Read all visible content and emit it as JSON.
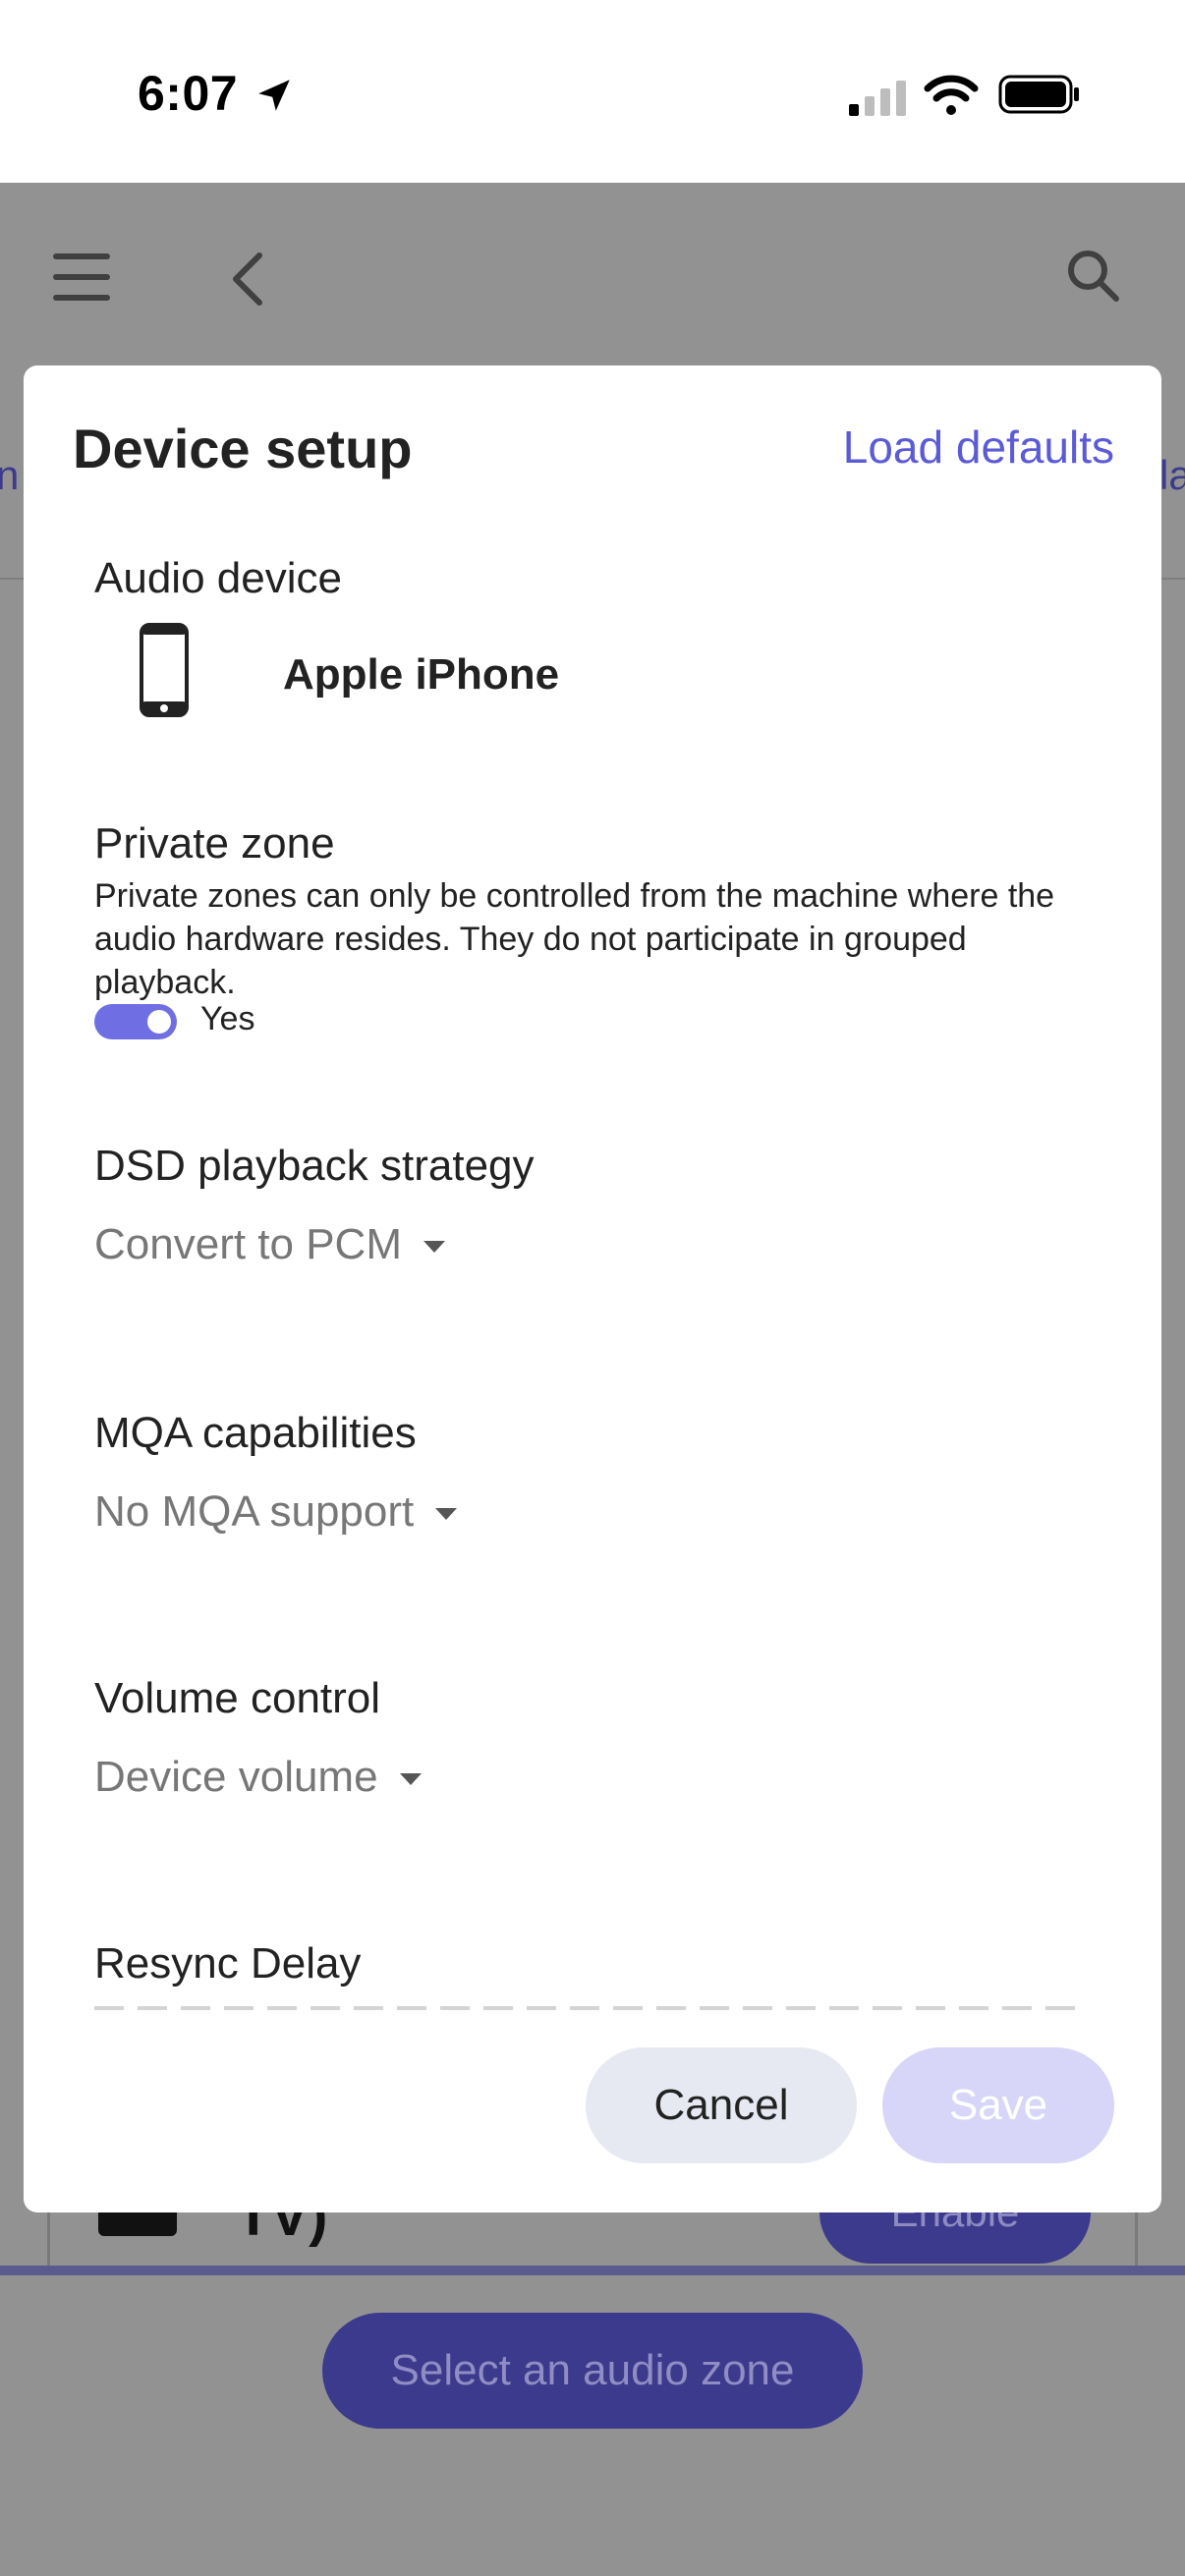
{
  "status_bar": {
    "time": "6:07"
  },
  "background_app": {
    "tab_left_fragment": "n",
    "tab_right_fragment": "la",
    "zone_name_fragment": "TV)",
    "zone_sub_fragment": "...",
    "enable_label": "Enable",
    "select_zone_label": "Select an audio zone"
  },
  "modal": {
    "title": "Device setup",
    "load_defaults_label": "Load defaults",
    "audio_device": {
      "label": "Audio device",
      "device_name": "Apple iPhone"
    },
    "private_zone": {
      "label": "Private zone",
      "description": "Private zones can only be controlled from the machine where the audio hardware resides. They do not participate in grouped playback.",
      "toggle_on": true,
      "toggle_label": "Yes"
    },
    "dsd": {
      "label": "DSD playback strategy",
      "value": "Convert to PCM"
    },
    "mqa": {
      "label": "MQA capabilities",
      "value": "No MQA support"
    },
    "volume": {
      "label": "Volume control",
      "value": "Device volume"
    },
    "resync": {
      "label": "Resync Delay"
    },
    "cancel_label": "Cancel",
    "save_label": "Save"
  },
  "colors": {
    "accent": "#5b5bd6",
    "toggle": "#6f6fe3",
    "save_disabled": "#d7d6f8",
    "overlay": "#929292"
  }
}
